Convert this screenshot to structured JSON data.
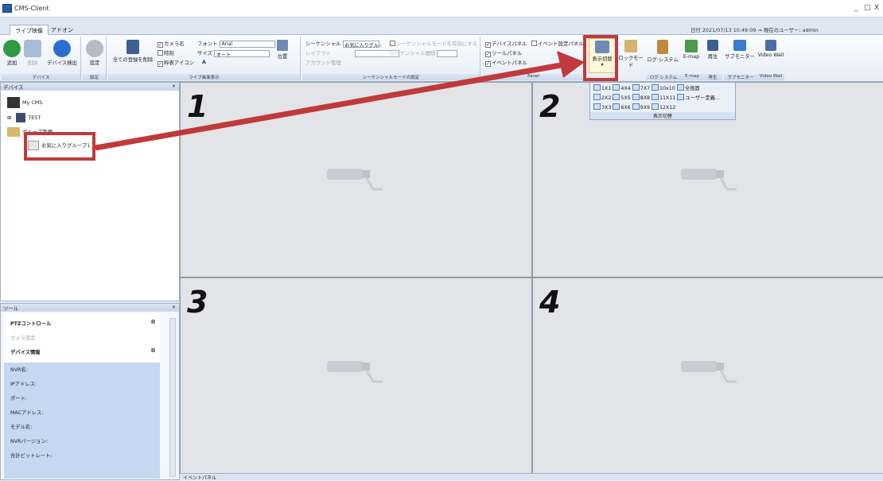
{
  "window": {
    "title": "CMS-Client",
    "min": "_",
    "max": "□",
    "close": "X"
  },
  "tabs": [
    {
      "label": "ライブ映像"
    },
    {
      "label": "アドオン"
    }
  ],
  "status": {
    "date_label": "日付",
    "date": "2021/07/13 10:49:09",
    "user_label": "現在のユーザー:",
    "user": "admin"
  },
  "ribbon": {
    "device": {
      "add": "追加",
      "delete": "削除",
      "detect": "デバイス検出",
      "group": "デバイス"
    },
    "settings": {
      "label": "設定",
      "group": "設定"
    },
    "live": {
      "clear_all": "全ての登録を削除",
      "camera_name": "カメラ名",
      "time": "時刻",
      "border_icon": "枠表アイコン",
      "font_label": "フォント",
      "font_value": "Arial",
      "size_label": "サイズ",
      "size_value": "オート",
      "color_label": "A",
      "position": "位置",
      "group": "ライブ画面表示"
    },
    "sequence": {
      "seq_label": "シーケンシャル",
      "seq_value": "お気に入りグル-:",
      "enable_seq": "シーケンシャルモードを有効にする",
      "layout": "レイアウト",
      "seq_interval": "シーケンシャル間隔",
      "account": "アカウント管理",
      "group": "シーケンシャルモードの設定"
    },
    "panel": {
      "device_panel": "デバイスパネル",
      "event_panel": "イベント設定パネル",
      "tool_panel": "ツールパネル",
      "event_panel2": "イベントパネル",
      "group": "Panel"
    },
    "display": {
      "switch": "表示切替",
      "lock": "ロックモード",
      "log": "ログ·システム",
      "emap": "E-map",
      "playback": "再生",
      "submonitor": "サブモニター",
      "videowall": "Video Wall",
      "g_log": "ログ·システム",
      "g_emap": "E-map",
      "g_play": "再生",
      "g_sub": "サブモニター",
      "g_vw": "Video Wall"
    }
  },
  "device_panel": {
    "title": "デバイス",
    "root": "My CMS",
    "test": "TEST",
    "group_mgmt": "グループ管理",
    "favorite": "お気に入りグループ1"
  },
  "tool_panel": {
    "title": "ツール",
    "ptz": "PTZコントロール",
    "camera_settings": "カメラ設定",
    "device_info": "デバイス情報",
    "fields": [
      "NVR名:",
      "IPアドレス:",
      "ポート:",
      "MACアドレス:",
      "モデル名:",
      "NVRバージョン:",
      "合計ビットレート:"
    ]
  },
  "cells": [
    {
      "num": "1"
    },
    {
      "num": "2"
    },
    {
      "num": "3"
    },
    {
      "num": "4"
    }
  ],
  "dropdown": {
    "rows": [
      [
        "1X1",
        "4X4",
        "7X7",
        "10x10",
        "全画面"
      ],
      [
        "2X2",
        "5X5",
        "8X8",
        "11X11",
        "ユーザー定義..."
      ],
      [
        "3X3",
        "6X6",
        "9X9",
        "12X12"
      ]
    ],
    "footer": "表示切替"
  },
  "bottom": {
    "event_panel": "イベントパネル"
  },
  "colors": {
    "annotation": "#c0393b",
    "ribbon_bg": "#e6edf7"
  }
}
